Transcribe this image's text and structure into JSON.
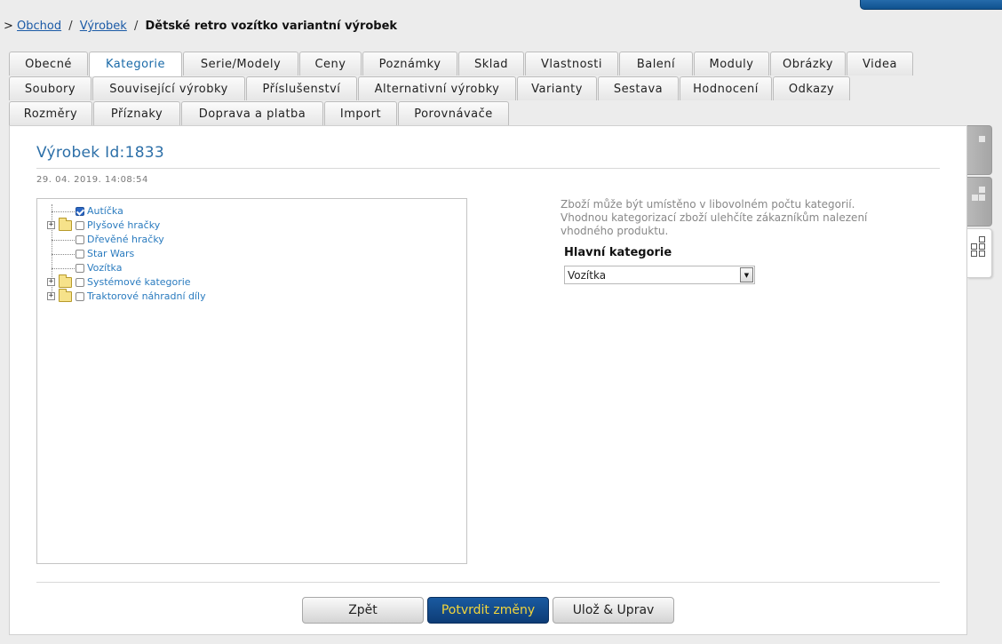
{
  "breadcrumb": {
    "prefix": ">",
    "links": [
      "Obchod",
      "Výrobek"
    ],
    "separator": "/",
    "current": "Dětské retro vozítko variantní výrobek"
  },
  "tabs": {
    "row1": [
      "Obecné",
      "Kategorie",
      "Serie/Modely",
      "Ceny",
      "Poznámky",
      "Sklad",
      "Vlastnosti",
      "Balení",
      "Moduly",
      "Obrázky",
      "Videa"
    ],
    "row2": [
      "Soubory",
      "Související výrobky",
      "Příslušenství",
      "Alternativní výrobky",
      "Varianty",
      "Sestava",
      "Hodnocení",
      "Odkazy"
    ],
    "row3": [
      "Rozměry",
      "Příznaky",
      "Doprava a platba",
      "Import",
      "Porovnávače"
    ],
    "active": "Kategorie"
  },
  "product": {
    "title": "Výrobek Id:1833",
    "datetime": "29. 04. 2019. 14:08:54"
  },
  "tree": [
    {
      "label": "Autíčka",
      "checked": true,
      "folder": false
    },
    {
      "label": "Plyšové hračky",
      "checked": false,
      "folder": true
    },
    {
      "label": "Dřevěné hračky",
      "checked": false,
      "folder": false
    },
    {
      "label": "Star Wars",
      "checked": false,
      "folder": false
    },
    {
      "label": "Vozítka",
      "checked": false,
      "folder": false
    },
    {
      "label": "Systémové kategorie",
      "checked": false,
      "folder": true
    },
    {
      "label": "Traktorové náhradní díly",
      "checked": false,
      "folder": true
    }
  ],
  "hint": {
    "line1": "Zboží může být umístěno v libovolném počtu kategorií.",
    "line2": "Vhodnou kategorizací zboží ulehčíte zákazníkům nalezení",
    "line3": "vhodného produktu."
  },
  "main_category": {
    "label": "Hlavní kategorie",
    "selected": "Vozítka"
  },
  "buttons": {
    "back": "Zpět",
    "confirm": "Potvrdit změny",
    "save_edit": "Ulož & Uprav"
  },
  "colors": {
    "link": "#2a7bbf",
    "title": "#2c6fa8",
    "confirm_bg": "#0d3c76",
    "confirm_text": "#f2d53c"
  }
}
